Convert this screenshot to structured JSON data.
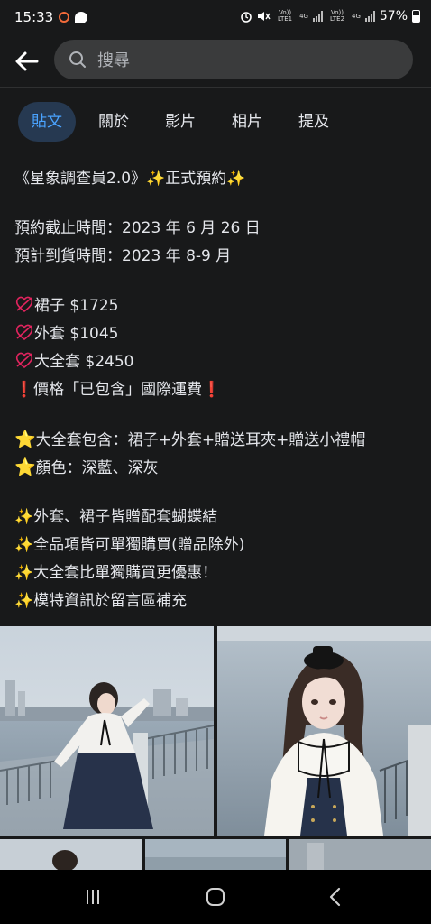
{
  "status": {
    "time": "15:33",
    "battery": "57%",
    "sim1": "Vo)) LTE1",
    "sim2": "Vo)) LTE2",
    "net1": "4G",
    "net2": "4G"
  },
  "search": {
    "placeholder": "搜尋"
  },
  "tabs": [
    {
      "label": "貼文",
      "active": true
    },
    {
      "label": "關於",
      "active": false
    },
    {
      "label": "影片",
      "active": false
    },
    {
      "label": "相片",
      "active": false
    },
    {
      "label": "提及",
      "active": false
    }
  ],
  "post": {
    "title": "《星象調查員2.0》",
    "title_suffix": "正式預約",
    "deadline": "預約截止時間：2023 年 6 月 26 日",
    "arrival": "預計到貨時間：2023 年 8-9 月",
    "prices": [
      "裙子 $1725",
      "外套 $1045",
      "大全套 $2450"
    ],
    "shipping_note": "價格「已包含」國際運費",
    "set_contents": "大全套包含：裙子+外套+贈送耳夾+贈送小禮帽",
    "colors": "顏色：深藍、深灰",
    "notes": [
      "外套、裙子皆贈配套蝴蝶結",
      "全品項皆可單獨購買(贈品除外)",
      "大全套比單獨購買更優惠！",
      "模特資訊於留言區補充"
    ]
  },
  "icons": {
    "back": "arrow-left-icon",
    "search": "search-icon",
    "sparkle": "sparkles-icon",
    "star": "star-icon",
    "exclamation": "red-exclamation-icon",
    "no_skirt": "no-symbol-icon"
  },
  "colors": {
    "accent": "#4aa3ff",
    "tab_active_bg": "#263951",
    "background": "#18191a"
  }
}
